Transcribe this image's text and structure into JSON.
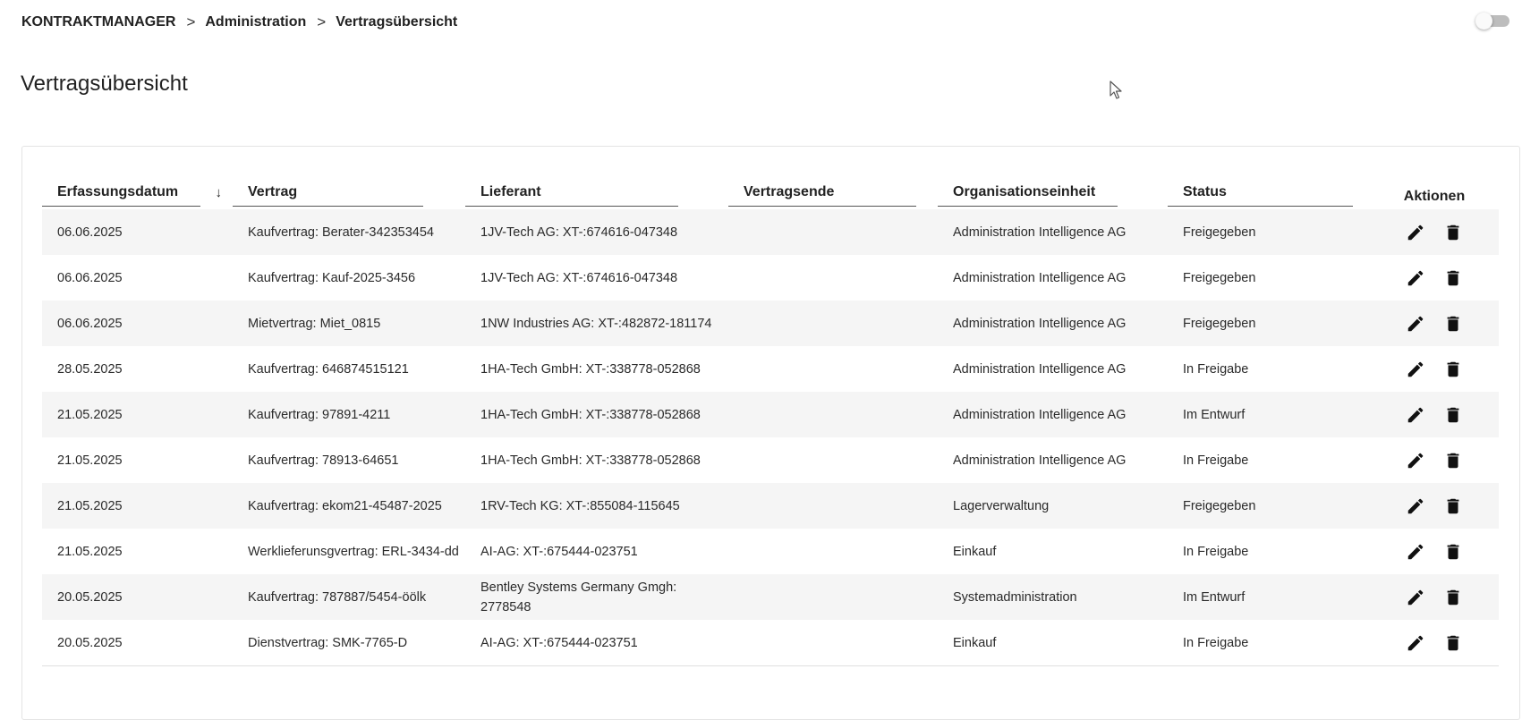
{
  "breadcrumb": {
    "items": [
      "KONTRAKTMANAGER",
      "Administration",
      "Vertragsübersicht"
    ],
    "separator": ">"
  },
  "page": {
    "title": "Vertragsübersicht"
  },
  "table": {
    "columns": {
      "erfassungsdatum": "Erfassungsdatum",
      "vertrag": "Vertrag",
      "lieferant": "Lieferant",
      "vertragsende": "Vertragsende",
      "organisationseinheit": "Organisationseinheit",
      "status": "Status",
      "aktionen": "Aktionen"
    },
    "sort": {
      "column": "Erfassungsdatum",
      "direction": "desc",
      "icon": "arrow-down-icon"
    },
    "rows": [
      {
        "datum": "06.06.2025",
        "vertrag": "Kaufvertrag: Berater-342353454",
        "lieferant": "1JV-Tech AG: XT-:674616-047348",
        "vertragsende": "",
        "org": "Administration Intelligence AG",
        "status": "Freigegeben"
      },
      {
        "datum": "06.06.2025",
        "vertrag": "Kaufvertrag: Kauf-2025-3456",
        "lieferant": "1JV-Tech AG: XT-:674616-047348",
        "vertragsende": "",
        "org": "Administration Intelligence AG",
        "status": "Freigegeben"
      },
      {
        "datum": "06.06.2025",
        "vertrag": "Mietvertrag: Miet_0815",
        "lieferant": "1NW Industries AG: XT-:482872-181174",
        "vertragsende": "",
        "org": "Administration Intelligence AG",
        "status": "Freigegeben"
      },
      {
        "datum": "28.05.2025",
        "vertrag": "Kaufvertrag: 646874515121",
        "lieferant": "1HA-Tech GmbH: XT-:338778-052868",
        "vertragsende": "",
        "org": "Administration Intelligence AG",
        "status": "In Freigabe"
      },
      {
        "datum": "21.05.2025",
        "vertrag": "Kaufvertrag: 97891-4211",
        "lieferant": "1HA-Tech GmbH: XT-:338778-052868",
        "vertragsende": "",
        "org": "Administration Intelligence AG",
        "status": "Im Entwurf"
      },
      {
        "datum": "21.05.2025",
        "vertrag": "Kaufvertrag: 78913-64651",
        "lieferant": "1HA-Tech GmbH: XT-:338778-052868",
        "vertragsende": "",
        "org": "Administration Intelligence AG",
        "status": "In Freigabe"
      },
      {
        "datum": "21.05.2025",
        "vertrag": "Kaufvertrag: ekom21-45487-2025",
        "lieferant": "1RV-Tech KG: XT-:855084-115645",
        "vertragsende": "",
        "org": "Lagerverwaltung",
        "status": "Freigegeben"
      },
      {
        "datum": "21.05.2025",
        "vertrag": "Werklieferunsgvertrag: ERL-3434-dd",
        "lieferant": "AI-AG: XT-:675444-023751",
        "vertragsende": "",
        "org": "Einkauf",
        "status": "In Freigabe"
      },
      {
        "datum": "20.05.2025",
        "vertrag": "Kaufvertrag: 787887/5454-öölk",
        "lieferant": "Bentley Systems Germany Gmgh: 2778548",
        "vertragsende": "",
        "org": "Systemadministration",
        "status": "Im Entwurf"
      },
      {
        "datum": "20.05.2025",
        "vertrag": "Dienstvertrag: SMK-7765-D",
        "lieferant": "AI-AG: XT-:675444-023751",
        "vertragsende": "",
        "org": "Einkauf",
        "status": "In Freigabe"
      }
    ],
    "row_actions": [
      "edit-icon",
      "delete-icon"
    ]
  },
  "toggle": {
    "state": "off"
  },
  "colors": {
    "row_stripe": "#f5f5f5",
    "text": "#212121",
    "toggle_track": "#bdbdbd"
  }
}
